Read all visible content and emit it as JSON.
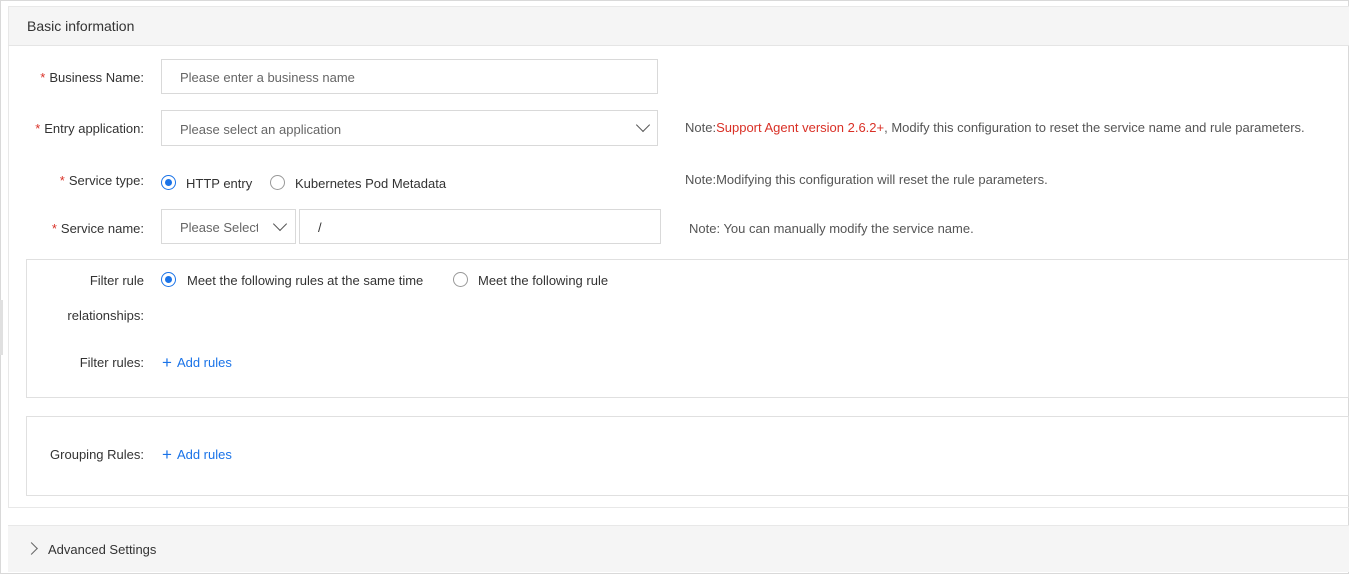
{
  "basic_info": {
    "title": "Basic information"
  },
  "form": {
    "business_name": {
      "label": "Business Name:",
      "required_mark": "*",
      "placeholder": "Please enter a business name"
    },
    "entry_application": {
      "label": "Entry application:",
      "required_mark": "*",
      "placeholder": "Please select an application",
      "note_prefix": "Note:",
      "note_highlight": "Support Agent version 2.6.2+",
      "note_rest": ", Modify this configuration to reset the service name and rule parameters."
    },
    "service_type": {
      "label": "Service type:",
      "required_mark": "*",
      "options": [
        {
          "label": "HTTP entry",
          "selected": true
        },
        {
          "label": "Kubernetes Pod Metadata",
          "selected": false
        }
      ],
      "note": "Note:Modifying this configuration will reset the rule parameters."
    },
    "service_name": {
      "label": "Service name:",
      "required_mark": "*",
      "select_placeholder": "Please Select",
      "path_value": "/",
      "note": "Note: You can manually modify the service name."
    },
    "filter_rule_relationships": {
      "label_line1": "Filter rule",
      "label_line2": "relationships:",
      "options": [
        {
          "label": "Meet the following rules at the same time",
          "selected": true
        },
        {
          "label": "Meet the following rule",
          "selected": false
        }
      ]
    },
    "filter_rules": {
      "label": "Filter rules:",
      "add_label": "Add rules"
    },
    "grouping_rules": {
      "label": "Grouping Rules:",
      "add_label": "Add rules"
    }
  },
  "advanced": {
    "title": "Advanced Settings"
  }
}
